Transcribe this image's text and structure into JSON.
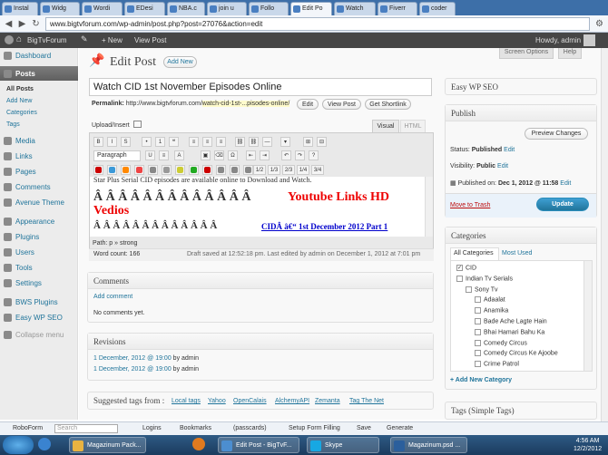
{
  "browser": {
    "tabs": [
      "Instal",
      "Widg",
      "Wordi",
      "EDesi",
      "NBA.c",
      "join u",
      "Follo",
      "Edit Po",
      "Watch",
      "Fiverr",
      "coder"
    ],
    "active_tab": 7,
    "url": "www.bigtvforum.com/wp-admin/post.php?post=27076&action=edit"
  },
  "adminbar": {
    "site": "BigTvForum",
    "new": "+ New",
    "view": "View Post",
    "howdy": "Howdy, admin"
  },
  "sidebar": {
    "items": [
      "Dashboard",
      "Posts",
      "Media",
      "Links",
      "Pages",
      "Comments",
      "Avenue Theme",
      "Appearance",
      "Plugins",
      "Users",
      "Tools",
      "Settings",
      "BWS Plugins",
      "Easy WP SEO",
      "Collapse menu"
    ],
    "subs": [
      "All Posts",
      "Add New",
      "Categories",
      "Tags"
    ]
  },
  "header": {
    "title": "Edit Post",
    "add_new": "Add New",
    "screen_options": "Screen Options",
    "help": "Help"
  },
  "post": {
    "title": "Watch CID 1st November Episodes Online",
    "permalink_label": "Permalink:",
    "permalink_base": "http://www.bigtvforum.com/",
    "permalink_slug": "watch-cid-1st-...pisodes-online/",
    "edit": "Edit",
    "view_post": "View Post",
    "get_shortlink": "Get Shortlink",
    "upload": "Upload/Insert",
    "visual": "Visual",
    "html": "HTML",
    "format": "Paragraph",
    "content_line1": "Star Plus Serial CID episodes are available online to Download and Watch.",
    "content_chars": "Â  Â  Â  Â  Â  Â  Â  Â  Â  Â  Â  Â  Â",
    "youtube_links": "Youtube Links HD",
    "vedios": "Vedios",
    "link_line": "CIDÂ â€“ 1st December 2012 Part 1",
    "path": "Path: p » strong",
    "word_count": "Word count: 166",
    "draft_saved": "Draft saved at 12:52:18 pm. Last edited by admin on December 1, 2012 at 7:01 pm"
  },
  "comments": {
    "title": "Comments",
    "add": "Add comment",
    "none": "No comments yet."
  },
  "revisions": {
    "title": "Revisions",
    "items": [
      {
        "date": "1 December, 2012 @ 19:00",
        "by": "by admin"
      },
      {
        "date": "1 December, 2012 @ 19:00",
        "by": "by admin"
      }
    ]
  },
  "suggested": {
    "label": "Suggested tags from :",
    "sources": [
      "Local tags",
      "Yahoo",
      "OpenCalais",
      "AlchemyAPI",
      "Zemanta",
      "Tag The Net"
    ]
  },
  "easyseo": "Easy WP SEO",
  "publish": {
    "title": "Publish",
    "preview": "Preview Changes",
    "status_label": "Status:",
    "status": "Published",
    "visibility_label": "Visibility:",
    "visibility": "Public",
    "published_on": "Published on:",
    "date": "Dec 1, 2012 @ 11:58",
    "edit": "Edit",
    "trash": "Move to Trash",
    "update": "Update"
  },
  "categories": {
    "title": "Categories",
    "tab_all": "All Categories",
    "tab_used": "Most Used",
    "items": [
      {
        "name": "CID",
        "checked": true,
        "level": 0
      },
      {
        "name": "Indian Tv Serials",
        "checked": false,
        "level": 0
      },
      {
        "name": "Sony Tv",
        "checked": false,
        "level": 1
      },
      {
        "name": "Adaalat",
        "checked": false,
        "level": 2
      },
      {
        "name": "Anamika",
        "checked": false,
        "level": 2
      },
      {
        "name": "Bade Ache Lagte Hain",
        "checked": false,
        "level": 2
      },
      {
        "name": "Bhai Hamari Bahu Ka",
        "checked": false,
        "level": 2
      },
      {
        "name": "Comedy Circus",
        "checked": false,
        "level": 2
      },
      {
        "name": "Comedy Circus Ke Ajoobe",
        "checked": false,
        "level": 2
      },
      {
        "name": "Crime Patrol",
        "checked": false,
        "level": 2
      }
    ],
    "add_new": "+ Add New Category"
  },
  "tags": {
    "title": "Tags (Simple Tags)"
  },
  "robobar": {
    "roboform": "RoboForm",
    "search": "Search",
    "logins": "Logins",
    "bookmarks": "Bookmarks",
    "passcards": "(passcards)",
    "setup": "Setup Form Filling",
    "save": "Save",
    "generate": "Generate"
  },
  "taskbar": {
    "items": [
      "Magazinum Pack...",
      "Edit Post - BigTvF...",
      "Skype",
      "Magazinum.psd ..."
    ],
    "time": "4:56 AM",
    "date": "12/2/2012"
  }
}
